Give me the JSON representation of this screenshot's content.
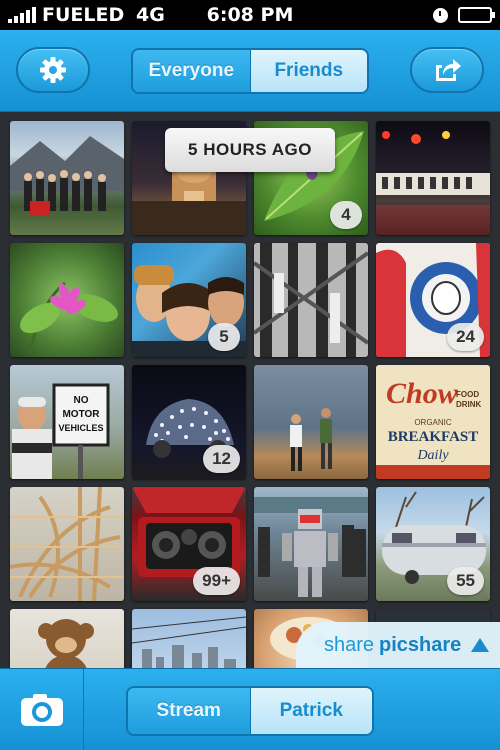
{
  "status_bar": {
    "carrier": "FUELED",
    "network": "4G",
    "time": "6:08 PM"
  },
  "top_bar": {
    "settings_icon": "gear-icon",
    "share_icon": "share-arrow-icon",
    "tabs": [
      {
        "label": "Everyone",
        "selected": false
      },
      {
        "label": "Friends",
        "selected": true
      }
    ]
  },
  "feed": {
    "tooltip": "5 HOURS AGO",
    "photos": [
      {
        "subject": "group-photo-mountains",
        "badge": ""
      },
      {
        "subject": "capitol-building-night",
        "badge": ""
      },
      {
        "subject": "green-leaf-bug",
        "badge": "4"
      },
      {
        "subject": "traffic-light-street-night",
        "badge": ""
      },
      {
        "subject": "pink-flower",
        "badge": ""
      },
      {
        "subject": "friends-selfie",
        "badge": "5"
      },
      {
        "subject": "metal-structure-bw",
        "badge": ""
      },
      {
        "subject": "street-art-skull",
        "badge": "24"
      },
      {
        "subject": "no-motor-vehicles-sign",
        "badge": ""
      },
      {
        "subject": "light-covered-car",
        "badge": "12"
      },
      {
        "subject": "people-walking-shore",
        "badge": ""
      },
      {
        "subject": "chow-breakfast-sign",
        "badge": ""
      },
      {
        "subject": "wooden-sculpture",
        "badge": ""
      },
      {
        "subject": "car-trunk-speakers",
        "badge": "99+"
      },
      {
        "subject": "robot-costume-crowd",
        "badge": ""
      },
      {
        "subject": "airstream-trailer",
        "badge": "55"
      },
      {
        "subject": "plush-monkey",
        "badge": ""
      },
      {
        "subject": "city-skyline",
        "badge": ""
      },
      {
        "subject": "food-plate",
        "badge": ""
      },
      {
        "subject": "partial-photo",
        "badge": ""
      }
    ]
  },
  "share_banner": {
    "prefix": "share",
    "brand": "picshare"
  },
  "bottom_bar": {
    "camera_icon": "camera-icon",
    "tabs": [
      {
        "label": "Stream",
        "selected": false
      },
      {
        "label": "Patrick",
        "selected": true
      }
    ]
  }
}
